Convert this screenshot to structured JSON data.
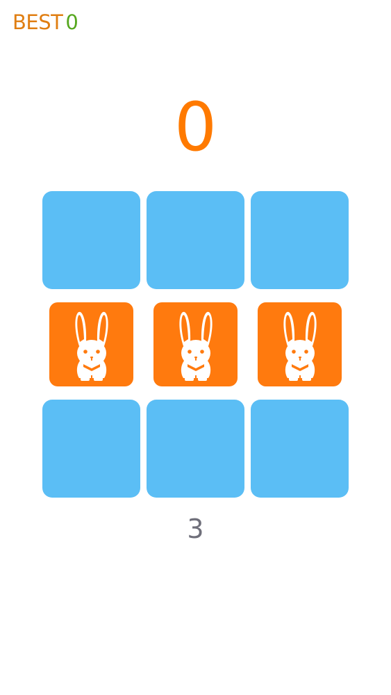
{
  "header": {
    "best_label": "BEST",
    "best_value": "0"
  },
  "game": {
    "score": "0",
    "counter": "3",
    "tiles": [
      {
        "row": 1,
        "col": 1,
        "state": "hidden"
      },
      {
        "row": 1,
        "col": 2,
        "state": "hidden"
      },
      {
        "row": 1,
        "col": 3,
        "state": "hidden"
      },
      {
        "row": 2,
        "col": 1,
        "state": "revealed",
        "icon": "rabbit-icon"
      },
      {
        "row": 2,
        "col": 2,
        "state": "revealed",
        "icon": "rabbit-icon"
      },
      {
        "row": 2,
        "col": 3,
        "state": "revealed",
        "icon": "rabbit-icon"
      },
      {
        "row": 3,
        "col": 1,
        "state": "hidden"
      },
      {
        "row": 3,
        "col": 2,
        "state": "hidden"
      },
      {
        "row": 3,
        "col": 3,
        "state": "hidden"
      }
    ]
  },
  "colors": {
    "best_label": "#e07e12",
    "best_value": "#56a71f",
    "score": "#ff7a00",
    "tile_hidden": "#5bbef5",
    "tile_revealed": "#ff7a0e",
    "counter": "#6f6f7a"
  }
}
